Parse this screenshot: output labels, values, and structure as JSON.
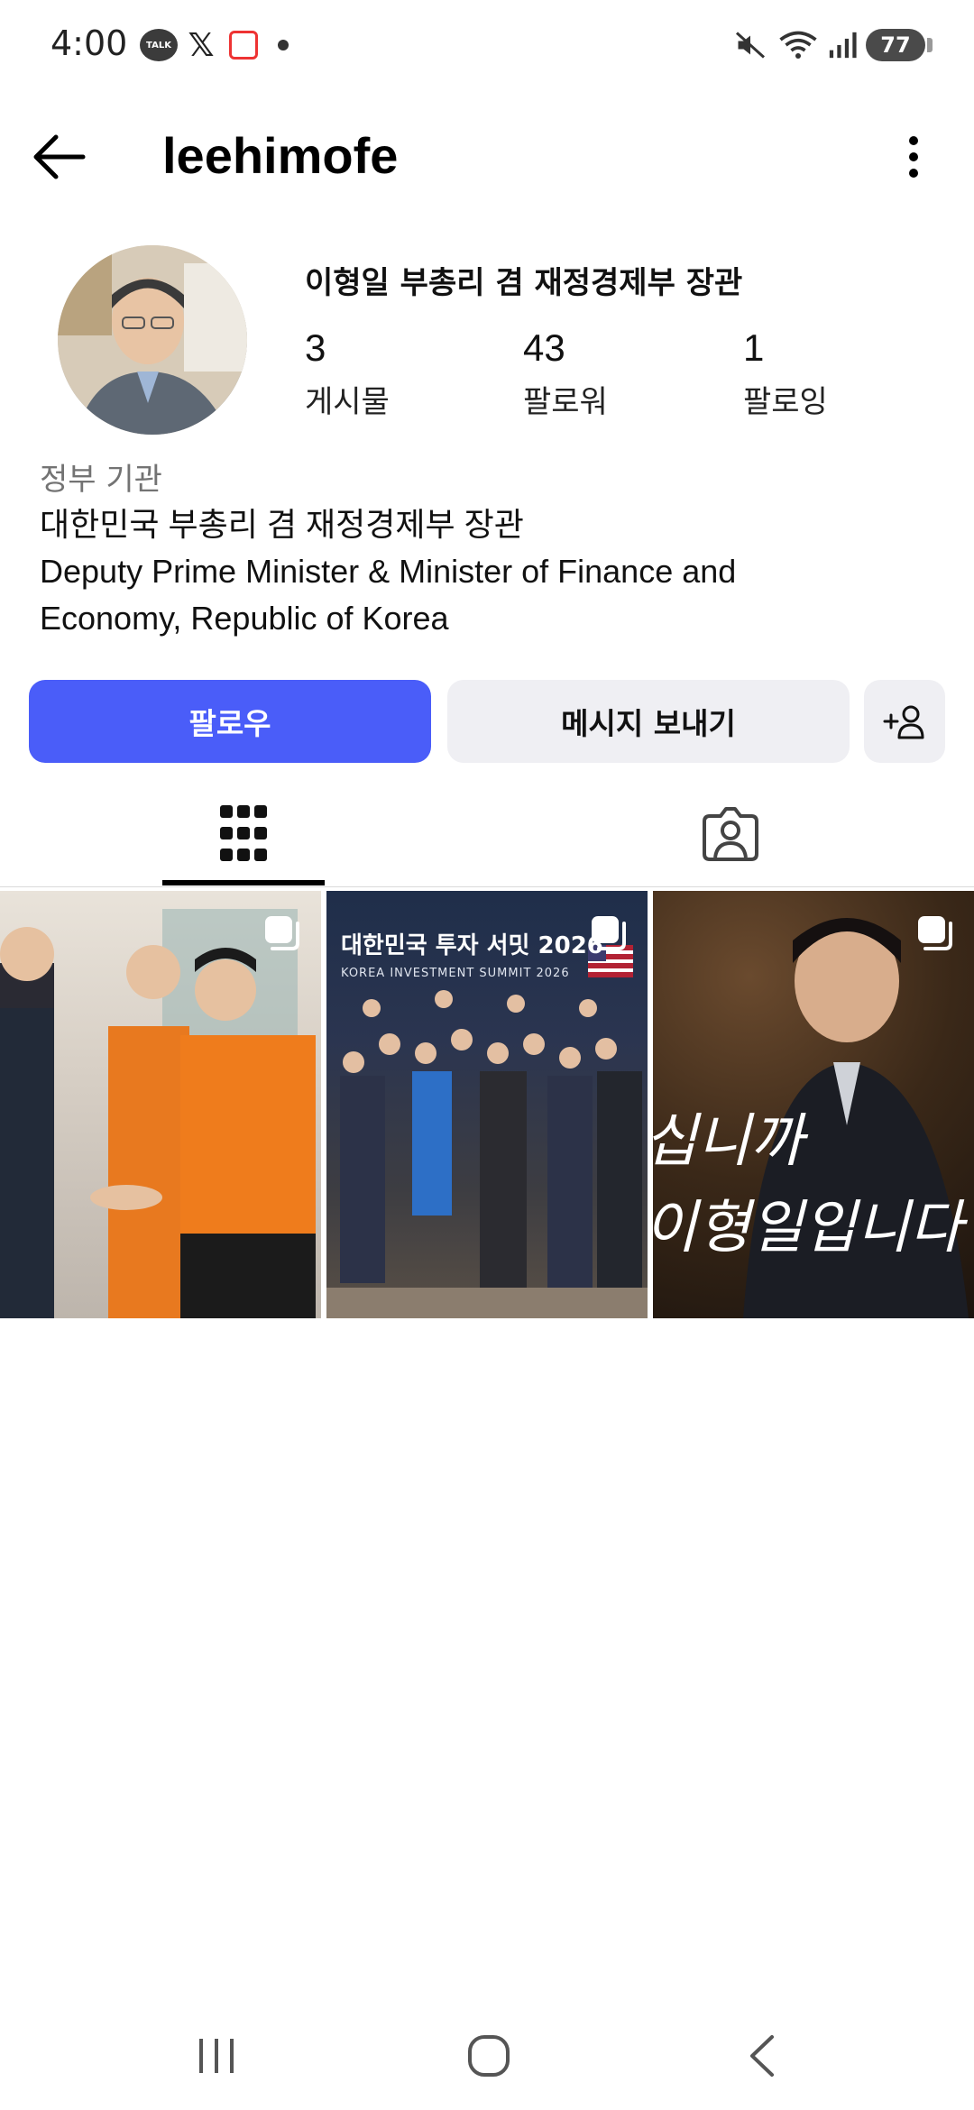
{
  "status_bar": {
    "time": "4:00",
    "talk_badge": "TALK",
    "x_logo": "𝕏",
    "battery": "77",
    "icons": [
      "kakaotalk-icon",
      "x-icon",
      "calendar-icon",
      "dot-icon",
      "mute-icon",
      "wifi-icon",
      "signal-icon",
      "battery-icon"
    ]
  },
  "header": {
    "username": "leehimofe"
  },
  "profile": {
    "display_name": "이형일 부총리 겸 재정경제부 장관",
    "stats": [
      {
        "count": "3",
        "label": "게시물"
      },
      {
        "count": "43",
        "label": "팔로워"
      },
      {
        "count": "1",
        "label": "팔로잉"
      }
    ],
    "category": "정부 기관",
    "bio_lines": [
      "대한민국 부총리 겸 재정경제부 장관",
      "Deputy Prime Minister & Minister of Finance and",
      "Economy, Republic of Korea"
    ]
  },
  "actions": {
    "follow_label": "팔로우",
    "message_label": "메시지 보내기"
  },
  "tabs": {
    "active": "posts-grid"
  },
  "posts": [
    {
      "caption": ""
    },
    {
      "caption": "대한민국 투자 서밋 2026",
      "subcaption": "KOREA INVESTMENT SUMMIT 2026"
    },
    {
      "script_line1": "십니까",
      "script_line2": "이형일입니다"
    }
  ],
  "colors": {
    "accent": "#4a5df9",
    "secondary_button": "#efeff3",
    "category_text": "#737373"
  }
}
